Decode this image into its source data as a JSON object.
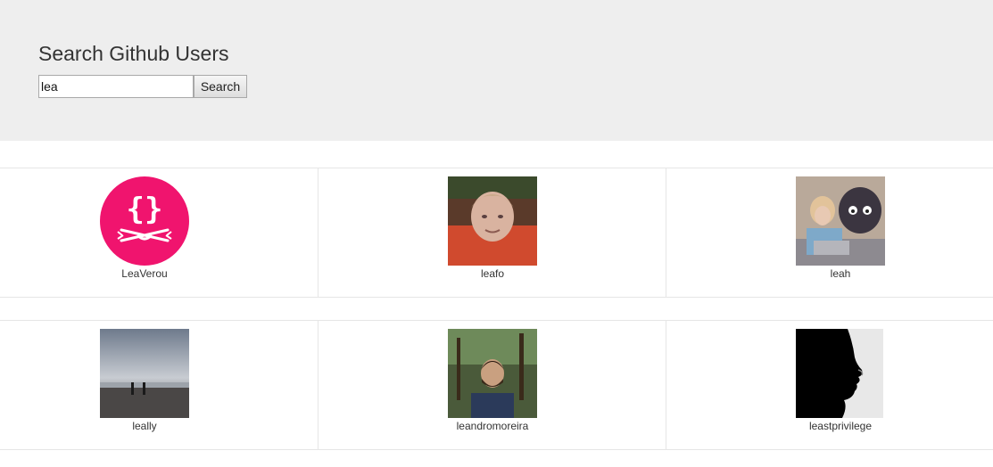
{
  "header": {
    "title": "Search Github Users"
  },
  "search": {
    "value": "lea",
    "button_label": "Search"
  },
  "results": [
    {
      "username": "LeaVerou",
      "avatar": "curly-braces-logo"
    },
    {
      "username": "leafo",
      "avatar": "boy-photo"
    },
    {
      "username": "leah",
      "avatar": "girl-octocat-photo"
    },
    {
      "username": "leally",
      "avatar": "beach-photo"
    },
    {
      "username": "leandromoreira",
      "avatar": "man-forest-photo"
    },
    {
      "username": "leastprivilege",
      "avatar": "profile-silhouette-photo"
    }
  ],
  "colors": {
    "header_bg": "#eeeeee",
    "logo_pink": "#f0146e"
  }
}
